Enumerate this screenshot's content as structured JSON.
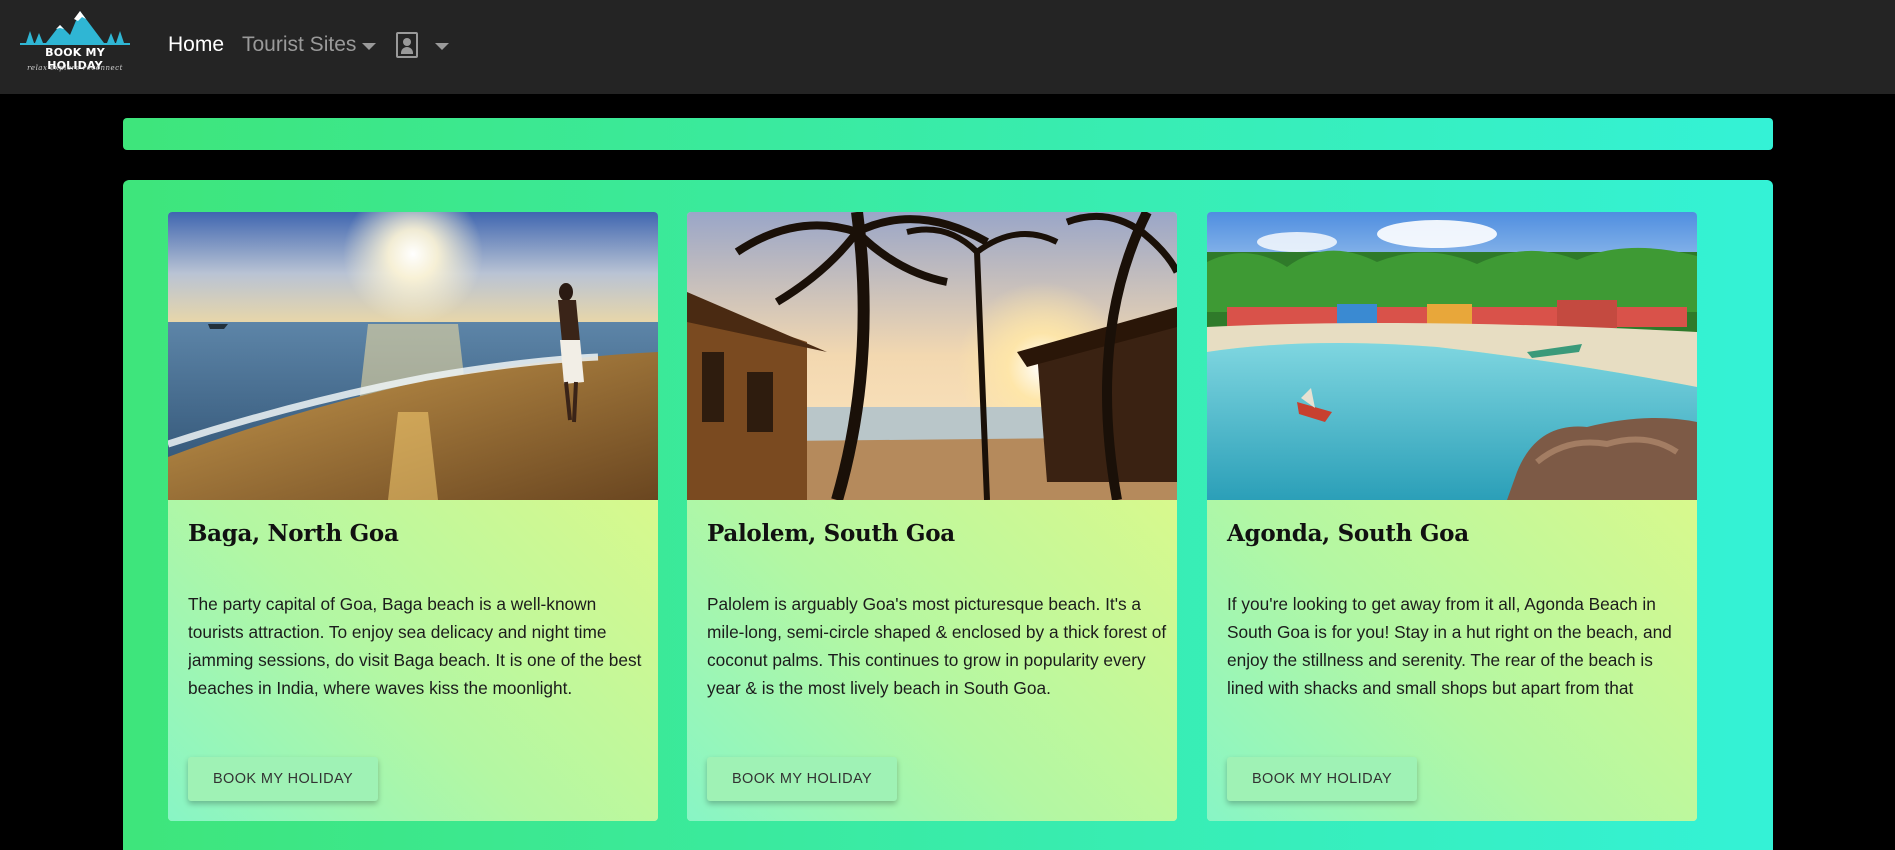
{
  "brand": {
    "logo_text": "BOOK MY HOLIDAY",
    "tagline": "relax explore reconnect"
  },
  "nav": {
    "home": "Home",
    "tourist_sites": "Tourist Sites"
  },
  "icons": {
    "logo": "mountain-logo-icon",
    "sites_dropdown": "chevron-down-icon",
    "user": "user-portrait-icon",
    "user_dropdown": "chevron-down-icon"
  },
  "colors": {
    "navbar": "#242424",
    "page_background": "#000000",
    "gradient_start": "#3ee57b",
    "gradient_end": "#34f2d6"
  },
  "cards": [
    {
      "title": "Baga, North Goa",
      "text": "The party capital of Goa, Baga beach is a well-known tourists attraction. To enjoy sea delicacy and night time jamming sessions, do visit Baga beach. It is one of the best beaches in India, where waves kiss the moonlight.",
      "button": "BOOK MY HOLIDAY"
    },
    {
      "title": "Palolem, South Goa",
      "text": "Palolem is arguably Goa's most picturesque beach. It's a mile-long, semi-circle shaped & enclosed by a thick forest of coconut palms. This continues to grow in popularity every year & is the most lively beach in South Goa.",
      "button": "BOOK MY HOLIDAY"
    },
    {
      "title": "Agonda, South Goa",
      "text": "If you're looking to get away from it all, Agonda Beach in South Goa is for you! Stay in a hut right on the beach, and enjoy the stillness and serenity. The rear of the beach is lined with shacks and small shops but apart from that",
      "button": "BOOK MY HOLIDAY"
    }
  ]
}
